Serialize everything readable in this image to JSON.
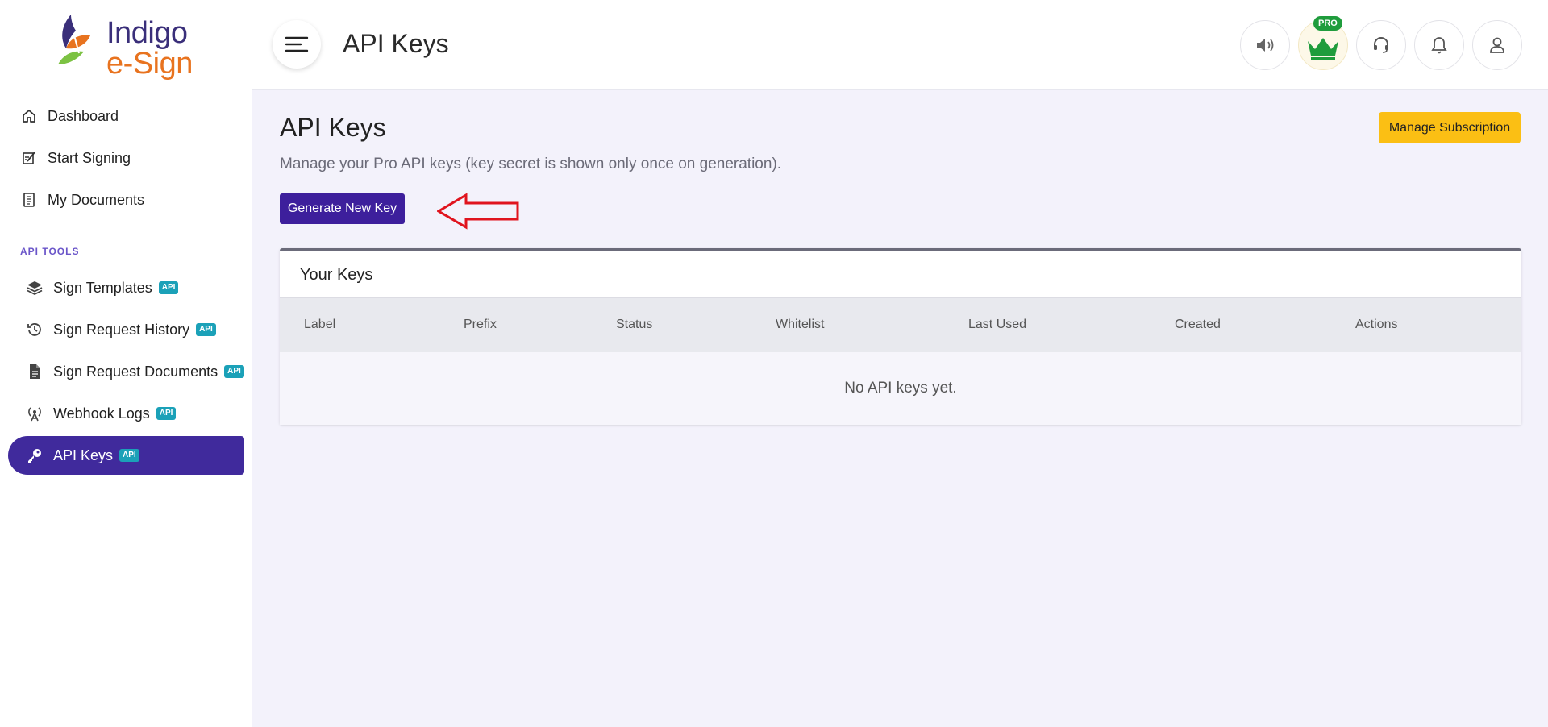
{
  "brand": {
    "line1": "Indigo",
    "line2": "e-Sign"
  },
  "sidebar": {
    "items": [
      {
        "label": "Dashboard",
        "icon": "home-icon"
      },
      {
        "label": "Start Signing",
        "icon": "sign-icon"
      },
      {
        "label": "My Documents",
        "icon": "document-icon"
      }
    ],
    "section_label": "API TOOLS",
    "api_items": [
      {
        "label": "Sign Templates",
        "badge": "API",
        "icon": "layers-icon"
      },
      {
        "label": "Sign Request History",
        "badge": "API",
        "icon": "history-icon"
      },
      {
        "label": "Sign Request Documents",
        "badge": "API",
        "icon": "file-icon"
      },
      {
        "label": "Webhook Logs",
        "badge": "API",
        "icon": "broadcast-icon"
      },
      {
        "label": "API Keys",
        "badge": "API",
        "icon": "key-icon",
        "active": true
      }
    ]
  },
  "header": {
    "title": "API Keys",
    "pro_badge": "PRO"
  },
  "main": {
    "title": "API Keys",
    "subtitle": "Manage your Pro API keys (key secret is shown only once on generation).",
    "manage_button": "Manage Subscription",
    "generate_button": "Generate New Key",
    "card": {
      "title": "Your Keys",
      "columns": [
        "Label",
        "Prefix",
        "Status",
        "Whitelist",
        "Last Used",
        "Created",
        "Actions"
      ],
      "empty_message": "No API keys yet."
    }
  },
  "colors": {
    "accent": "#402a9c",
    "manage": "#fbbf14",
    "badge": "#1ba1b8",
    "annotation_arrow": "#e0141e"
  }
}
